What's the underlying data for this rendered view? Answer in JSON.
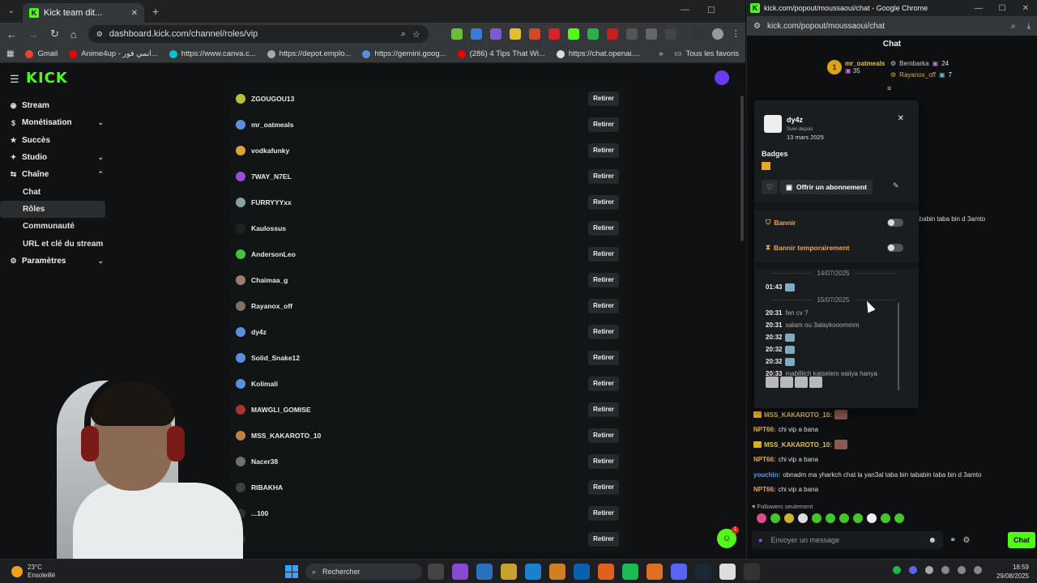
{
  "left_window": {
    "tab_title": "Kick team dit...",
    "url": "dashboard.kick.com/channel/roles/vip",
    "bookmarks": [
      "Gmail",
      "Anime4up - انمي فور...",
      "https://www.canva.c...",
      "https://depot.emplo...",
      "https://gemini.goog...",
      "(286) 4 Tips That Wi...",
      "https://chat.openai...."
    ],
    "bookmarks_all": "Tous les favoris",
    "logo": "KICK",
    "sidebar": [
      {
        "label": "Stream",
        "icon": "stream-icon",
        "chevron": ""
      },
      {
        "label": "Monétisation",
        "icon": "dollar-icon",
        "chevron": "⌄"
      },
      {
        "label": "Succès",
        "icon": "star-icon",
        "chevron": ""
      },
      {
        "label": "Studio",
        "icon": "studio-icon",
        "chevron": "⌄"
      },
      {
        "label": "Chaîne",
        "icon": "channel-icon",
        "chevron": "⌃"
      }
    ],
    "sidebar_sub": [
      "Chat",
      "Rôles",
      "Communauté",
      "URL et clé du stream"
    ],
    "sidebar_settings": "Paramètres",
    "roles": [
      {
        "name": "ZGOUGOU13",
        "color": "#b9c23a"
      },
      {
        "name": "mr_oatmeals",
        "color": "#5b8de3"
      },
      {
        "name": "vodkafunky",
        "color": "#d9a430"
      },
      {
        "name": "7WAY_N7EL",
        "color": "#9b49e0"
      },
      {
        "name": "FURRYYYxx",
        "color": "#8aa0a0"
      },
      {
        "name": "Kaulossus",
        "color": "#222222"
      },
      {
        "name": "AndersonLeo",
        "color": "#3cc43a"
      },
      {
        "name": "Chaimaa_g",
        "color": "#a07a6a"
      },
      {
        "name": "Rayanox_off",
        "color": "#807060"
      },
      {
        "name": "dy4z",
        "color": "#5b8de3"
      },
      {
        "name": "Solid_Snake12",
        "color": "#5b8de3"
      },
      {
        "name": "Kolimali",
        "color": "#5b8de3"
      },
      {
        "name": "MAWGLI_GOMISE",
        "color": "#b03030"
      },
      {
        "name": "MSS_KAKAROTO_10",
        "color": "#c08040"
      },
      {
        "name": "Nacer38",
        "color": "#707070"
      },
      {
        "name": "RIBAKHA",
        "color": "#404040"
      },
      {
        "name": "...100",
        "color": "#303030"
      },
      {
        "name": "",
        "color": "#303030"
      }
    ],
    "retirer_label": "Retirer"
  },
  "right_window": {
    "title": "kick.com/popout/moussaoui/chat - Google Chrome",
    "url": "kick.com/popout/moussaoui/chat",
    "chat_header": "Chat",
    "gifters": {
      "first_name": "mr_oatmeals",
      "first_count": "35",
      "second_name": "Bembarka",
      "second_count": "24",
      "third_name": "Rayanox_off",
      "third_count": "7"
    },
    "partial_behind_card": "tababin taba bin d 3amto",
    "messages": [
      {
        "user": "MSS_KAKAROTO_10:",
        "text": "",
        "emote": true,
        "type": "kak"
      },
      {
        "user": "NPT66:",
        "text": "chi vip a bana",
        "emote": false,
        "type": "npt"
      },
      {
        "user": "MSS_KAKAROTO_10:",
        "text": "",
        "emote": true,
        "type": "kak"
      },
      {
        "user": "NPT66:",
        "text": "chi vip a bana",
        "emote": false,
        "type": "npt"
      },
      {
        "user": "youchin:",
        "text": "obnadm ma yharkch chat la yan3al taba bin tababin taba bin d 3amto",
        "emote": false,
        "type": "you"
      },
      {
        "user": "NPT66:",
        "text": "chi vip a bana",
        "emote": false,
        "type": "npt"
      }
    ],
    "followers_only": "Followers seulement",
    "message_placeholder": "Envoyer un message",
    "chat_button": "Chat"
  },
  "user_card": {
    "username": "dy4z",
    "followed_label": "Suivi depuis",
    "followed_date": "13 mars 2025",
    "badges_title": "Badges",
    "gift_sub": "Offrir un abonnement",
    "ban": "Bannir",
    "timeout": "Bannir temporairement",
    "date1": "14/07/2025",
    "date2": "15/07/2025",
    "log": [
      {
        "time": "01:43",
        "text": "",
        "emote": true
      },
      {
        "time": "20:31",
        "text": "fen cv ?",
        "emote": false
      },
      {
        "time": "20:31",
        "text": "salam ou 3alaykooommm",
        "emote": false
      },
      {
        "time": "20:32",
        "text": "",
        "emote": true
      },
      {
        "time": "20:32",
        "text": "",
        "emote": true
      },
      {
        "time": "20:32",
        "text": "",
        "emote": true
      },
      {
        "time": "20:33",
        "text": "mab8lich katselem eaiiya hanya",
        "emote": false
      }
    ]
  },
  "taskbar": {
    "temp": "23°C",
    "weather": "Ensoleillé",
    "search": "Rechercher",
    "time": "18:59",
    "date": "29/08/2025"
  }
}
